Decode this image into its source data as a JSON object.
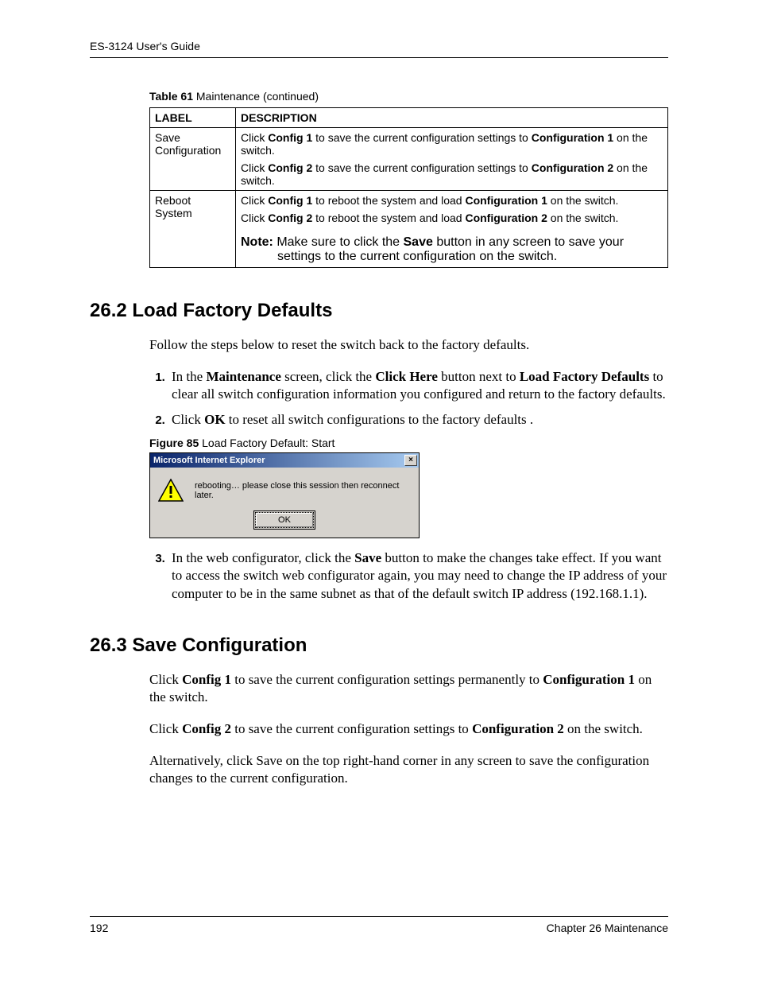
{
  "header": {
    "running_head": "ES-3124 User's Guide"
  },
  "table61": {
    "caption_label": "Table 61",
    "caption_rest": "   Maintenance  (continued)",
    "col_label": "LABEL",
    "col_desc": "DESCRIPTION",
    "rows": [
      {
        "label": "Save Configuration",
        "p1_a": "Click ",
        "p1_b": "Config 1",
        "p1_c": " to save the current configuration settings to ",
        "p1_d": "Configuration 1",
        "p1_e": " on the switch.",
        "p2_a": "Click ",
        "p2_b": "Config 2",
        "p2_c": " to save the current configuration settings to ",
        "p2_d": "Configuration 2",
        "p2_e": " on the switch."
      },
      {
        "label": "Reboot System",
        "p1_a": "Click ",
        "p1_b": "Config 1",
        "p1_c": " to reboot the system and load ",
        "p1_d": "Configuration 1",
        "p1_e": " on the switch.",
        "p2_a": "Click ",
        "p2_b": "Config 2",
        "p2_c": " to reboot the system and load ",
        "p2_d": "Configuration 2",
        "p2_e": " on the switch.",
        "note_label": "Note: ",
        "note_a": "Make sure to click the ",
        "note_b": "Save",
        "note_c": " button in any screen to save your",
        "note_d": "settings to the current configuration on the switch."
      }
    ]
  },
  "sec262": {
    "heading": "26.2  Load Factory Defaults",
    "intro": "Follow the steps below to reset the switch back to the factory defaults.",
    "step1_a": "In the ",
    "step1_b": "Maintenance",
    "step1_c": " screen, click the ",
    "step1_d": "Click Here",
    "step1_e": " button next to ",
    "step1_f": "Load Factory Defaults",
    "step1_g": " to clear all switch configuration information you configured and return to the factory defaults.",
    "step2_a": "Click ",
    "step2_b": "OK",
    "step2_c": " to reset all switch configurations to the factory defaults .",
    "fig_label": "Figure 85",
    "fig_rest": "   Load Factory Default: Start",
    "dialog": {
      "title": "Microsoft Internet Explorer",
      "close": "×",
      "message": "rebooting… please close this session then reconnect later.",
      "ok": "OK"
    },
    "step3_a": "In the web configurator, click the ",
    "step3_b": "Save",
    "step3_c": " button to make the changes take effect. If you want to access the switch web configurator again, you may need to change the IP address of your computer to be in the same subnet as that of the default switch IP address (192.168.1.1)."
  },
  "sec263": {
    "heading": "26.3  Save Configuration",
    "p1_a": "Click ",
    "p1_b": "Config 1",
    "p1_c": " to save the current configuration settings permanently to ",
    "p1_d": "Configuration 1",
    "p1_e": " on the switch.",
    "p2_a": "Click ",
    "p2_b": "Config 2",
    "p2_c": " to save the current configuration settings to ",
    "p2_d": "Configuration 2",
    "p2_e": " on the switch.",
    "p3": "Alternatively, click Save on the top right-hand corner in any screen to save the configuration changes to the current configuration."
  },
  "footer": {
    "page": "192",
    "chapter": "Chapter 26 Maintenance"
  }
}
